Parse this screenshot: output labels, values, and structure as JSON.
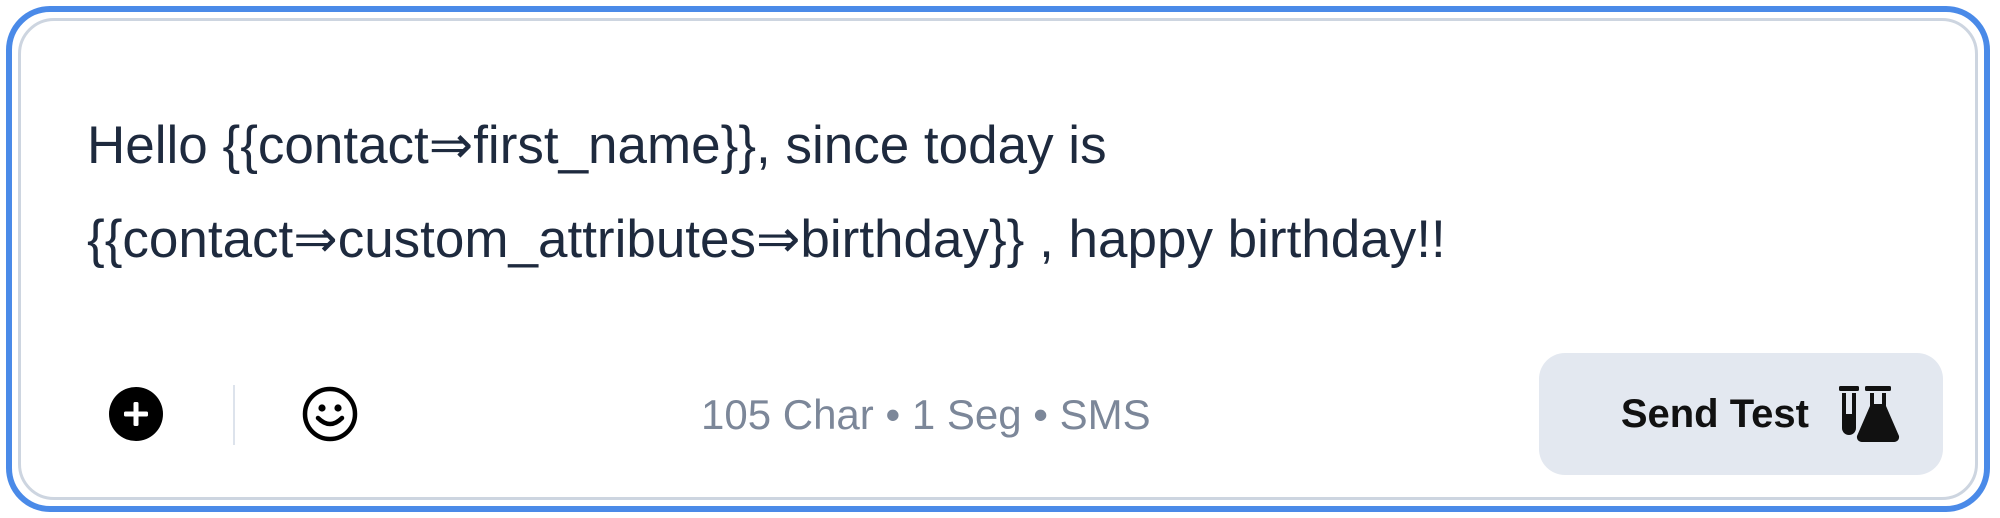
{
  "message": {
    "text": "Hello {{contact⇒first_name}}, since today is\n{{contact⇒custom_attributes⇒birthday}} , happy birthday!!"
  },
  "toolbar": {
    "add_icon": "plus-circle-icon",
    "emoji_icon": "smiley-icon",
    "counter_text": "105 Char • 1 Seg • SMS",
    "send_test_label": "Send Test",
    "send_test_icon": "flask-icon"
  },
  "colors": {
    "focus_border": "#4a8ae8",
    "inner_border": "#cdd5e0",
    "text": "#1e2a3e",
    "muted_text": "#7c8799",
    "button_bg": "#e3e8f0"
  }
}
